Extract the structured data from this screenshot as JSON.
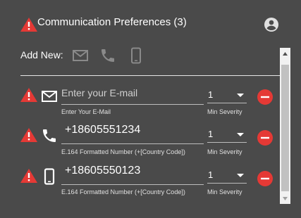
{
  "header": {
    "title": "Communication Preferences (3)"
  },
  "add_new": {
    "label": "Add New:",
    "icons": [
      "email-icon",
      "phone-icon",
      "mobile-icon"
    ]
  },
  "rows": [
    {
      "type_icon": "email-icon",
      "value": "",
      "placeholder": "Enter your E-mail",
      "helper": "Enter Your E-Mail",
      "severity": "1",
      "severity_label": "Min Severity"
    },
    {
      "type_icon": "phone-icon",
      "value": "+18605551234",
      "placeholder": "",
      "helper": "E.164 Formatted Number (+[Country Code])",
      "severity": "1",
      "severity_label": "Min Severity"
    },
    {
      "type_icon": "mobile-icon",
      "value": "+18605550123",
      "placeholder": "",
      "helper": "E.164 Formatted Number (+[Country Code])",
      "severity": "1",
      "severity_label": "Min Severity"
    }
  ],
  "colors": {
    "warning": "#e53935",
    "remove": "#e53935",
    "background": "#4a4a4a",
    "inactive_icon": "#8a8a8a"
  }
}
